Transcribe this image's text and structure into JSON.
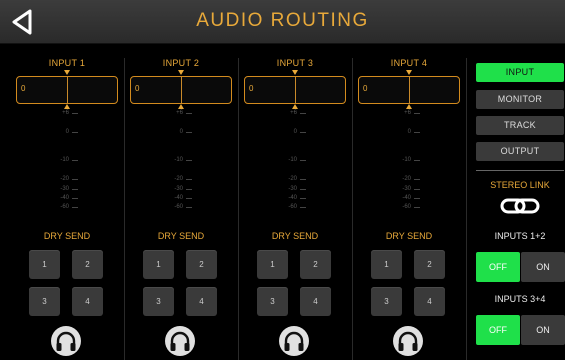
{
  "header": {
    "title": "AUDIO ROUTING",
    "back_icon": "back-triangle-icon"
  },
  "scale_labels": [
    "+6",
    "0",
    "-10",
    "-20",
    "-30",
    "-40",
    "-60"
  ],
  "channels": [
    {
      "label": "INPUT 1",
      "value": "0",
      "dry_send": "DRY SEND",
      "buttons": [
        "1",
        "2",
        "3",
        "4"
      ]
    },
    {
      "label": "INPUT 2",
      "value": "0",
      "dry_send": "DRY SEND",
      "buttons": [
        "1",
        "2",
        "3",
        "4"
      ]
    },
    {
      "label": "INPUT 3",
      "value": "0",
      "dry_send": "DRY SEND",
      "buttons": [
        "1",
        "2",
        "3",
        "4"
      ]
    },
    {
      "label": "INPUT 4",
      "value": "0",
      "dry_send": "DRY SEND",
      "buttons": [
        "1",
        "2",
        "3",
        "4"
      ]
    }
  ],
  "sidebar": {
    "tabs": [
      {
        "label": "INPUT",
        "active": true
      },
      {
        "label": "MONITOR",
        "active": false
      },
      {
        "label": "TRACK",
        "active": false
      },
      {
        "label": "OUTPUT",
        "active": false
      }
    ],
    "stereo_link": "STEREO LINK",
    "link_icon": "chain-link-icon",
    "pairs": [
      {
        "label": "INPUTS 1+2",
        "off": "OFF",
        "on": "ON",
        "selected": "OFF"
      },
      {
        "label": "INPUTS 3+4",
        "off": "OFF",
        "on": "ON",
        "selected": "OFF"
      }
    ]
  },
  "colors": {
    "accent": "#e8a93a",
    "active_green": "#1fe04a",
    "button_gray": "#3a3a3a",
    "background": "#000000"
  }
}
